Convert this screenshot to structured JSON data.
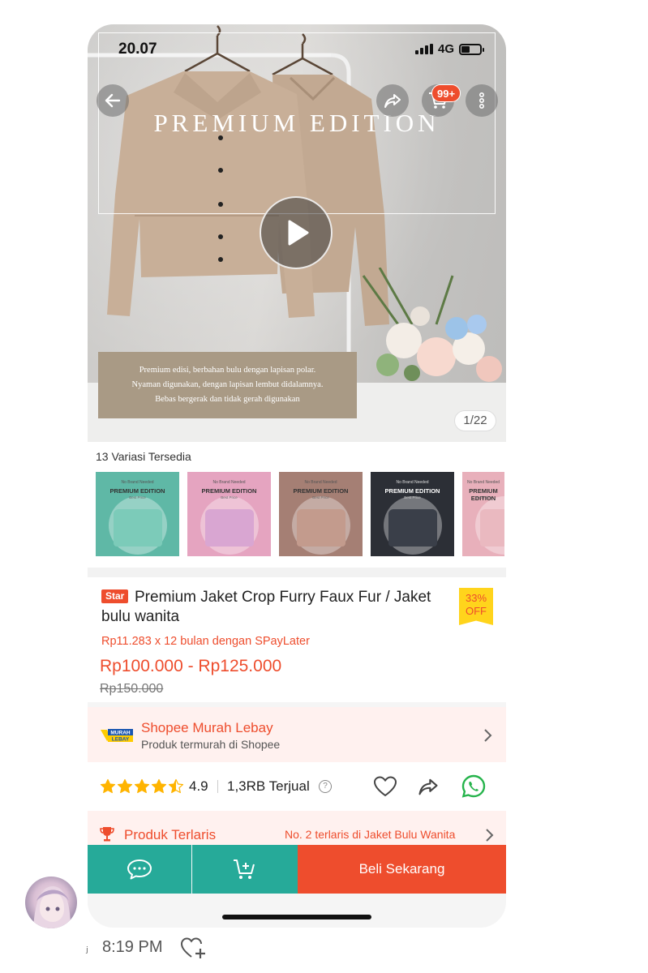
{
  "status_bar": {
    "time": "20.07",
    "network": "4G"
  },
  "header": {
    "cart_badge": "99+"
  },
  "hero": {
    "title": "PREMIUM EDITION",
    "description_lines": [
      "Premium edisi, berbahan  bulu dengan lapisan polar.",
      "Nyaman digunakan, dengan lapisan lembut didalamnya.",
      "Bebas bergerak dan tidak gerah digunakan"
    ],
    "page_counter": "1/22"
  },
  "variations": {
    "title": "13 Variasi Tersedia",
    "card_brand": "No Brand Needed",
    "card_title": "PREMIUM EDITION",
    "card_sub": "Best Price",
    "items": [
      {
        "bg": "#5fb8a6",
        "jacket": "#7ccbb9"
      },
      {
        "bg": "#e5a4c0",
        "jacket": "#d9a6d2"
      },
      {
        "bg": "#a57f74",
        "jacket": "#c39b8d"
      },
      {
        "bg": "#2c2f36",
        "jacket": "#3a3f49"
      },
      {
        "bg": "#e8b0bb",
        "jacket": "#eab9c0"
      }
    ]
  },
  "product": {
    "badge": "Star",
    "title_line1": "Premium Jaket Crop Furry Faux Fur / Jaket",
    "title_line2": "bulu wanita",
    "discount_pct": "33%",
    "discount_label": "OFF",
    "paylater": "Rp11.283 x 12 bulan dengan SPayLater",
    "price_range": "Rp100.000 - Rp125.000",
    "original_price": "Rp150.000"
  },
  "murah_lebay": {
    "logo_top": "MURAH",
    "logo_bottom": "LEBAY",
    "title": "Shopee Murah Lebay",
    "subtitle": "Produk termurah di Shopee"
  },
  "rating": {
    "value": "4.9",
    "stars": 4.5,
    "sold": "1,3RB Terjual"
  },
  "bestseller": {
    "label": "Produk Terlaris",
    "info": "No. 2 terlaris di Jaket Bulu Wanita"
  },
  "actions": {
    "buy_now": "Beli Sekarang"
  },
  "message_meta": {
    "time": "8:19 PM"
  },
  "colors": {
    "accent": "#ee4d2d",
    "teal": "#26aa99",
    "promo_bg": "#fff1ef"
  }
}
